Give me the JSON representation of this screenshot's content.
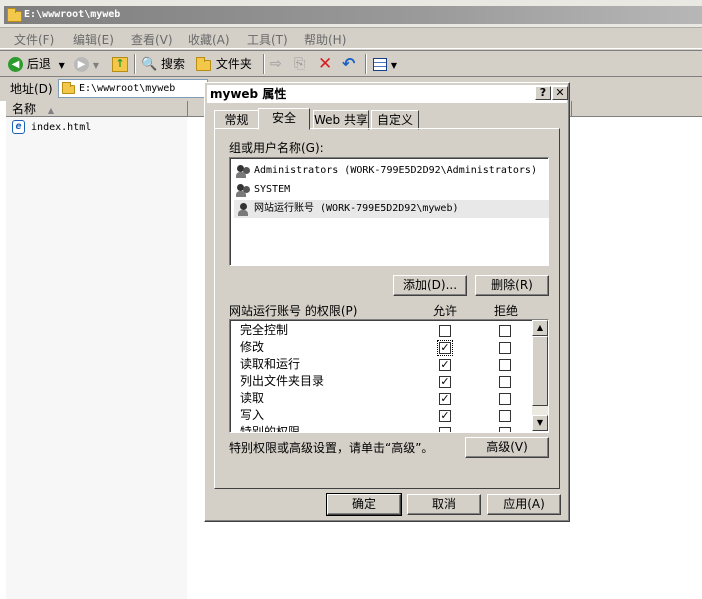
{
  "window": {
    "title": "E:\\wwwroot\\myweb"
  },
  "menu": [
    "文件(F)",
    "编辑(E)",
    "查看(V)",
    "收藏(A)",
    "工具(T)",
    "帮助(H)"
  ],
  "toolbar": {
    "back": "后退",
    "search": "搜索",
    "folders": "文件夹"
  },
  "address": {
    "label": "地址(D)",
    "value": "E:\\wwwroot\\myweb"
  },
  "list": {
    "col_name": "名称",
    "files": [
      "index.html"
    ]
  },
  "dialog": {
    "title": "myweb 属性",
    "tabs": [
      "常规",
      "安全",
      "Web 共享",
      "自定义"
    ],
    "active_tab": "安全",
    "groups_label": "组或用户名称(G):",
    "users": [
      "Administrators (WORK-799E5D2D92\\Administrators)",
      "SYSTEM",
      "网站运行账号 (WORK-799E5D2D92\\myweb)"
    ],
    "add_button": "添加(D)...",
    "remove_button": "删除(R)",
    "perm_label": "网站运行账号 的权限(P)",
    "allow_label": "允许",
    "deny_label": "拒绝",
    "permissions": [
      {
        "name": "完全控制",
        "allow": false,
        "deny": false
      },
      {
        "name": "修改",
        "allow": true,
        "deny": false
      },
      {
        "name": "读取和运行",
        "allow": true,
        "deny": false
      },
      {
        "name": "列出文件夹目录",
        "allow": true,
        "deny": false
      },
      {
        "name": "读取",
        "allow": true,
        "deny": false
      },
      {
        "name": "写入",
        "allow": true,
        "deny": false
      },
      {
        "name": "特别的权限",
        "allow": false,
        "deny": false
      }
    ],
    "advanced_hint": "特别权限或高级设置，请单击“高级”。",
    "advanced_button": "高级(V)",
    "ok_button": "确定",
    "cancel_button": "取消",
    "apply_button": "应用(A)"
  },
  "colors": {
    "folder": "#f3c84a",
    "back_icon": "#2e9b2e",
    "delete_icon": "#d42020",
    "undo_icon": "#1a62c4"
  }
}
